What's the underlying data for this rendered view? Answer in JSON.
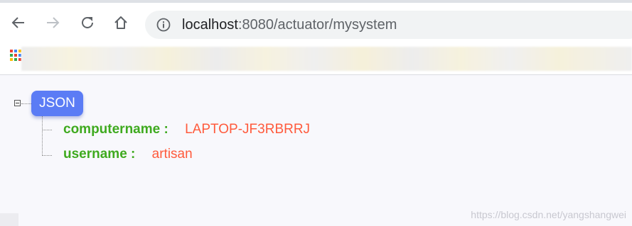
{
  "browser": {
    "url_host": "localhost",
    "url_rest": ":8080/actuator/mysystem"
  },
  "json_view": {
    "root_label": "JSON",
    "entries": [
      {
        "key": "computername :",
        "value": "LAPTOP-JF3RBRRJ"
      },
      {
        "key": "username :",
        "value": "artisan"
      }
    ]
  },
  "watermark": "https://blog.csdn.net/yangshangwei"
}
